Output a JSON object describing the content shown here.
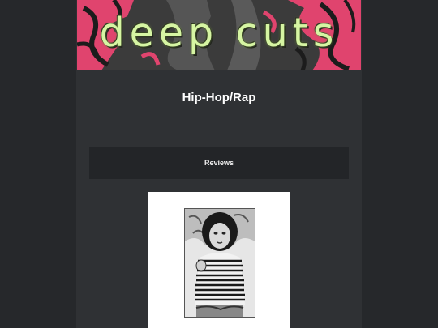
{
  "banner": {
    "title": "deep cuts",
    "colors": {
      "pink": "#e0446e",
      "dark": "#3a3a3a",
      "text": "#d6f5a3"
    }
  },
  "page": {
    "title": "Hip-Hop/Rap"
  },
  "tabs": {
    "reviews_label": "Reviews"
  },
  "card": {
    "image_icon": "album-cover-image"
  },
  "colors": {
    "background": "#26282b",
    "column": "#2f3134",
    "tab": "#232528",
    "card": "#ffffff"
  }
}
